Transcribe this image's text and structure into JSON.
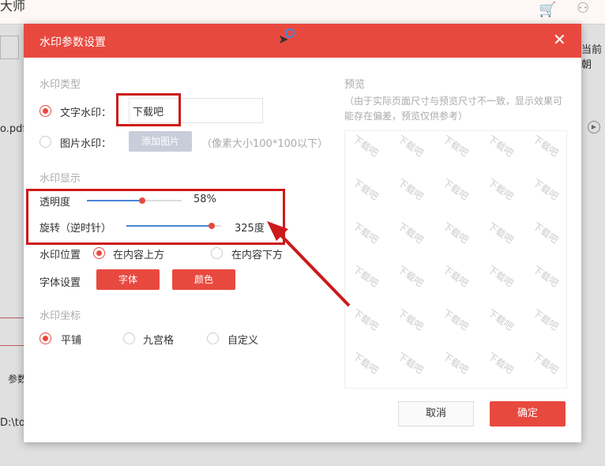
{
  "background": {
    "app_title": "大师",
    "right_text": "当前朝",
    "file_text": "o.pdf",
    "param_text": "参数",
    "path_text": "D:\\to"
  },
  "dialog": {
    "title": "水印参数设置",
    "type_section": "水印类型",
    "text_wm_label": "文字水印：",
    "text_wm_value": "下载吧",
    "image_wm_label": "图片水印：",
    "add_image_button": "添加图片",
    "image_hint": "（像素大小100*100以下）",
    "display_section": "水印显示",
    "opacity_label": "透明度",
    "opacity_value": "58%",
    "opacity_fraction": 0.58,
    "rotation_label": "旋转（逆时针）",
    "rotation_value": "325度",
    "rotation_fraction": 0.9,
    "position_label": "水印位置",
    "position_above": "在内容上方",
    "position_below": "在内容下方",
    "font_label": "字体设置",
    "font_button": "字体",
    "color_button": "颜色",
    "coord_section": "水印坐标",
    "coord_tile": "平铺",
    "coord_grid": "九宫格",
    "coord_custom": "自定义",
    "preview_title": "预览",
    "preview_note": "（由于实际页面尺寸与预览尺寸不一致，显示效果可能存在偏差，预览仅供参考）",
    "cancel": "取消",
    "ok": "确定"
  },
  "colors": {
    "accent": "#e8493f",
    "annotation": "#cc1a1a"
  }
}
